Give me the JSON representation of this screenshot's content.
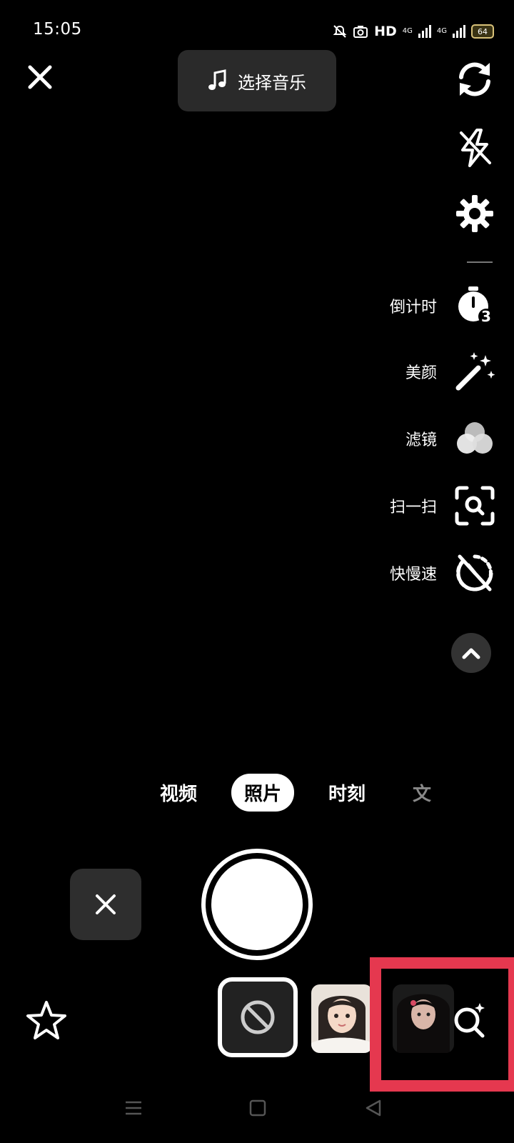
{
  "status_bar": {
    "time": "15:05",
    "network_label": "HD",
    "signal_1_label": "4G",
    "signal_2_label": "4G",
    "battery": "64"
  },
  "top": {
    "music_label": "选择音乐"
  },
  "tools": [
    {
      "label": "倒计时",
      "icon": "countdown-timer-icon"
    },
    {
      "label": "美颜",
      "icon": "magic-wand-icon"
    },
    {
      "label": "滤镜",
      "icon": "filter-circles-icon"
    },
    {
      "label": "扫一扫",
      "icon": "scan-icon"
    },
    {
      "label": "快慢速",
      "icon": "speed-icon"
    }
  ],
  "countdown_badge": "3",
  "modes": [
    {
      "label": "视频",
      "active": false
    },
    {
      "label": "照片",
      "active": true
    },
    {
      "label": "时刻",
      "active": false
    },
    {
      "label": "文",
      "active": false
    }
  ],
  "colors": {
    "background": "#000000",
    "highlight": "#e5384f",
    "pill": "#2a2a2a"
  }
}
